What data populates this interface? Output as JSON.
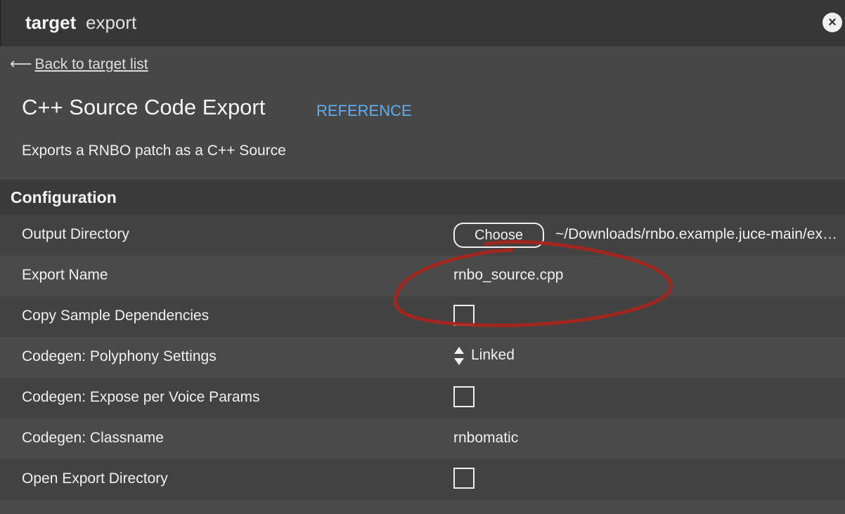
{
  "window": {
    "title_strong": "target",
    "title_light": "export",
    "close_glyph": "×"
  },
  "nav": {
    "back_arrow": "⟵",
    "back_label": "Back to target list"
  },
  "header": {
    "title": "C++ Source Code Export",
    "reference_label": "REFERENCE",
    "description": "Exports a RNBO patch as a C++ Source"
  },
  "configuration": {
    "section_title": "Configuration",
    "output_directory": {
      "label": "Output Directory",
      "button_label": "Choose",
      "path": "~/Downloads/rnbo.example.juce-main/export"
    },
    "export_name": {
      "label": "Export Name",
      "value": "rnbo_source.cpp"
    },
    "copy_sample_dependencies": {
      "label": "Copy Sample Dependencies",
      "checked": false
    },
    "polyphony_settings": {
      "label": "Codegen: Polyphony Settings",
      "value": "Linked"
    },
    "expose_per_voice_params": {
      "label": "Codegen: Expose per Voice Params",
      "checked": false
    },
    "classname": {
      "label": "Codegen: Classname",
      "value": "rnbomatic"
    },
    "open_export_directory": {
      "label": "Open Export Directory",
      "checked": false
    }
  },
  "colors": {
    "background": "#474747",
    "titlebar": "#373737",
    "reference_link": "#62acec",
    "annotation_stroke": "#a8251c"
  },
  "icons": {
    "close": "close-icon",
    "back": "back-arrow-icon",
    "stepper": "up-down-stepper-icon"
  }
}
